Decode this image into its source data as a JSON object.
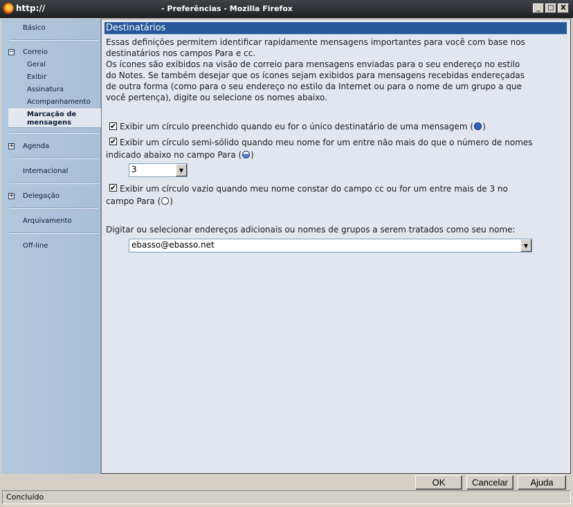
{
  "window": {
    "url_label": "http://",
    "title": "- Preferências - Mozilla Firefox",
    "minimize": "_",
    "maximize": "□",
    "close": "X"
  },
  "sidebar": {
    "basico": "Básico",
    "correio": "Correio",
    "geral": "Geral",
    "exibir": "Exibir",
    "assinatura": "Assinatura",
    "acompanhamento": "Acompanhamento",
    "marcacao_line1": "Marcação de",
    "marcacao_line2": "mensagens",
    "agenda": "Agenda",
    "internacional": "Internacional",
    "delegacao": "Delegação",
    "arquivamento": "Arquivamento",
    "offline": "Off-line",
    "expand_symbol": "+",
    "collapse_symbol": "−"
  },
  "main": {
    "header": "Destinatários",
    "intro_line1": "Essas definições permitem identificar rapidamente mensagens importantes para você com base nos",
    "intro_line2": "destinatários nos campos Para e cc.",
    "intro_line3": "Os ícones são exibidos na visão de correio para mensagens enviadas para o seu endereço no estilo",
    "intro_line4": "do Notes. Se também desejar que os ícones sejam exibidos para mensagens recebidas endereçadas",
    "intro_line5": "de outra forma (como para o seu endereço no estilo da Internet ou para o nome de um grupo a que",
    "intro_line6": "você pertença), digite ou selecione os nomes abaixo.",
    "option1": {
      "checked": true,
      "text": "Exibir um círculo preenchido quando eu for o único destinatário de uma mensagem ("
    },
    "option2": {
      "checked": true,
      "text_line1": "Exibir um círculo semi-sólido quando meu nome for um entre não mais do que o número de nomes",
      "text_line2": "indicado abaixo no campo Para ("
    },
    "count_select": {
      "value": "3"
    },
    "option3": {
      "checked": true,
      "text_line1": "Exibir um círculo vazio quando meu nome constar do campo cc ou for um entre mais de 3 no",
      "text_line2": "campo Para ("
    },
    "close_paren": ")",
    "checkmark": "✔",
    "address_prompt": "Digitar ou selecionar endereços adicionais ou nomes de grupos a serem tratados como seu nome:",
    "address_value": "ebasso@ebasso.net",
    "dropdown_arrow": "▼"
  },
  "buttons": {
    "ok": "OK",
    "cancel": "Cancelar",
    "help": "Ajuda"
  },
  "status": "Concluído"
}
